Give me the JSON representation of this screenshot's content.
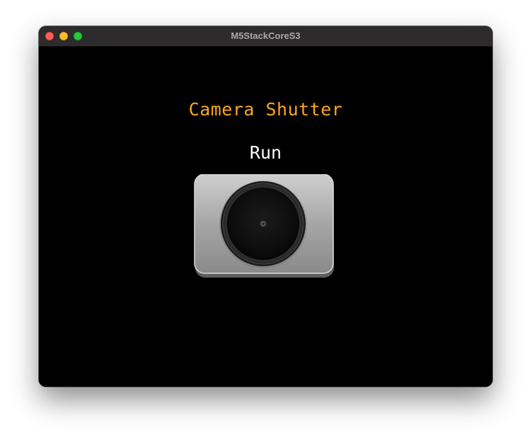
{
  "window": {
    "title": "M5StackCoreS3"
  },
  "app": {
    "title": "Camera Shutter",
    "status": "Run"
  },
  "icons": {
    "traffic_close": "close-icon",
    "traffic_minimize": "minimize-icon",
    "traffic_zoom": "zoom-icon",
    "shutter": "camera-shutter-icon"
  },
  "colors": {
    "title_text": "#fba71a",
    "status_text": "#ffffff",
    "screen_background": "#000000"
  }
}
